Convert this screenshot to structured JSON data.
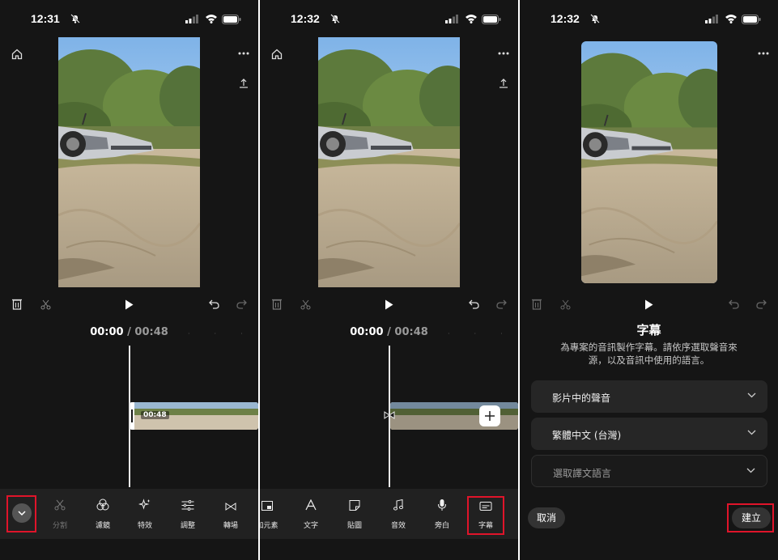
{
  "panel1": {
    "status_time": "12:31",
    "timecode_current": "00:00",
    "timecode_separator": "/",
    "timecode_total": "00:48",
    "clip_duration": "00:48",
    "tools": [
      {
        "label": "分割",
        "icon": "scissors-icon",
        "enabled": false
      },
      {
        "label": "濾鏡",
        "icon": "filters-icon",
        "enabled": true
      },
      {
        "label": "特效",
        "icon": "sparkle-icon",
        "enabled": true
      },
      {
        "label": "調整",
        "icon": "sliders-icon",
        "enabled": true
      },
      {
        "label": "轉場",
        "icon": "bowtie-icon",
        "enabled": true
      }
    ]
  },
  "panel2": {
    "status_time": "12:32",
    "timecode_current": "00:00",
    "timecode_separator": "/",
    "timecode_total": "00:48",
    "tools": [
      {
        "label": "加元素",
        "icon": "element-icon"
      },
      {
        "label": "文字",
        "icon": "text-icon"
      },
      {
        "label": "貼圖",
        "icon": "sticker-icon"
      },
      {
        "label": "音效",
        "icon": "music-note-icon"
      },
      {
        "label": "旁白",
        "icon": "microphone-icon"
      },
      {
        "label": "字幕",
        "icon": "captions-icon"
      }
    ]
  },
  "panel3": {
    "status_time": "12:32",
    "sheet_title": "字幕",
    "sheet_description": "為專案的音訊製作字幕。請依序選取聲音來源，以及音訊中使用的語言。",
    "select_source": "影片中的聲音",
    "select_language": "繁體中文 (台灣)",
    "select_translation": "選取譯文語言",
    "cancel_label": "取消",
    "create_label": "建立"
  },
  "colors": {
    "background": "#151515",
    "toolbar": "#212121",
    "highlight": "#e0142a",
    "select_bg": "#262626"
  }
}
